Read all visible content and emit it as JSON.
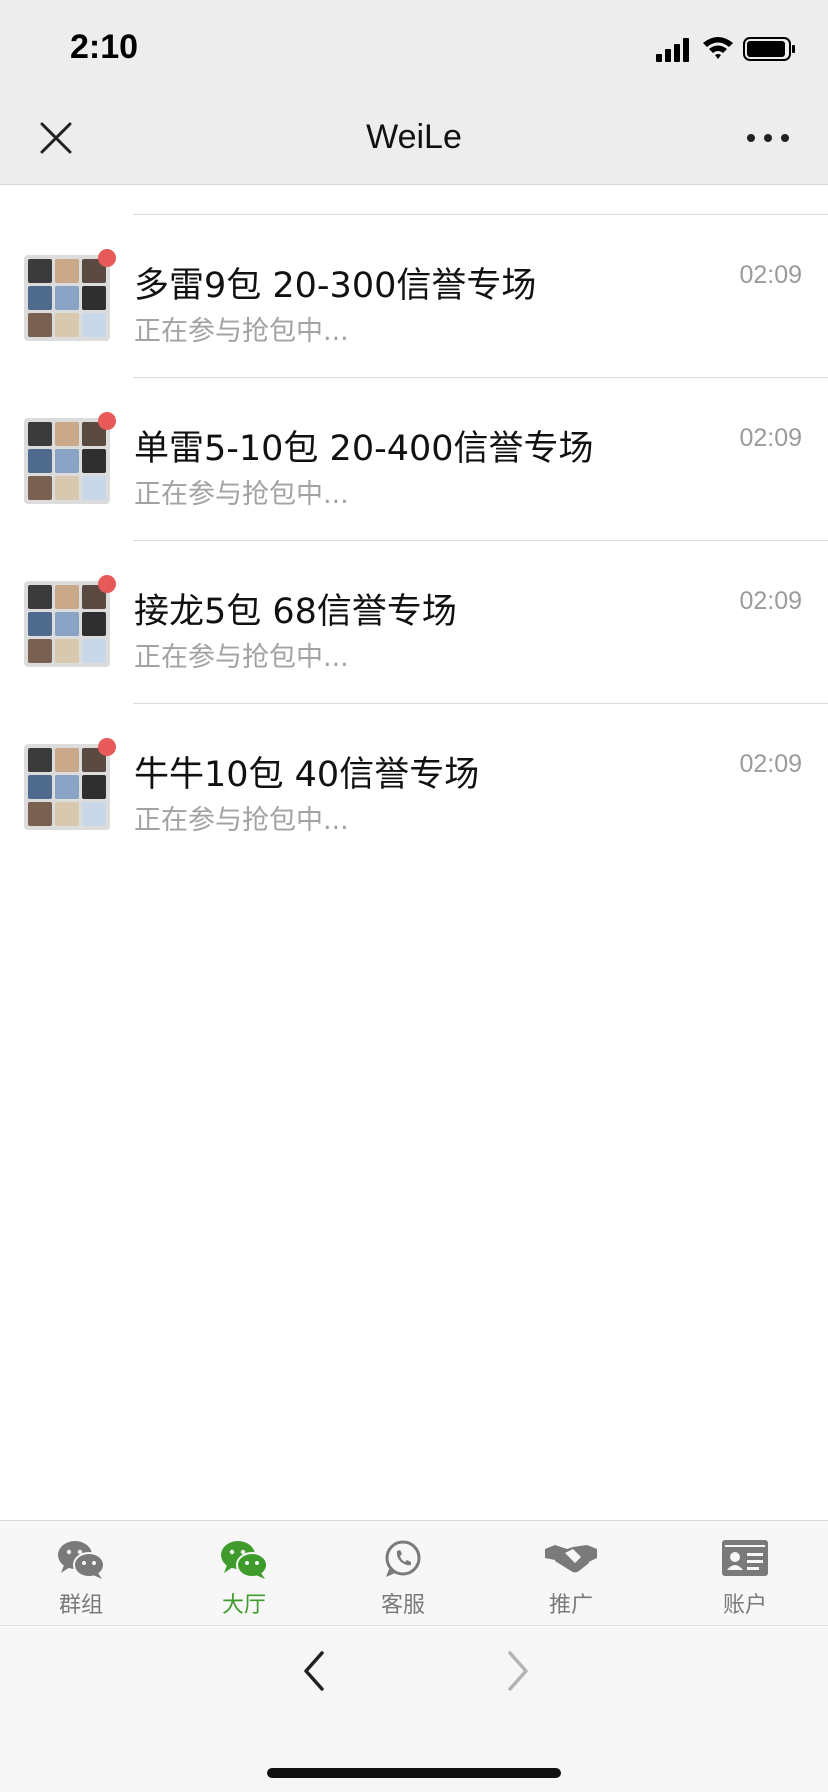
{
  "status_bar": {
    "time": "2:10"
  },
  "nav": {
    "title": "WeiLe"
  },
  "rooms": [
    {
      "title": "多雷9包 20-300信誉专场",
      "subtitle": "正在参与抢包中...",
      "time": "02:09"
    },
    {
      "title": "单雷5-10包 20-400信誉专场",
      "subtitle": "正在参与抢包中...",
      "time": "02:09"
    },
    {
      "title": "接龙5包 68信誉专场",
      "subtitle": "正在参与抢包中...",
      "time": "02:09"
    },
    {
      "title": "牛牛10包 40信誉专场",
      "subtitle": "正在参与抢包中...",
      "time": "02:09"
    }
  ],
  "tabs": [
    {
      "label": "群组",
      "icon": "chat-bubbles-icon"
    },
    {
      "label": "大厅",
      "icon": "chat-bubbles-icon",
      "active": true
    },
    {
      "label": "客服",
      "icon": "phone-bubble-icon"
    },
    {
      "label": "推广",
      "icon": "handshake-icon"
    },
    {
      "label": "账户",
      "icon": "id-card-icon"
    }
  ],
  "colors": {
    "accent_green": "#3f9c2c",
    "unread_dot": "#e85a5a",
    "header_bg": "#ededed"
  }
}
